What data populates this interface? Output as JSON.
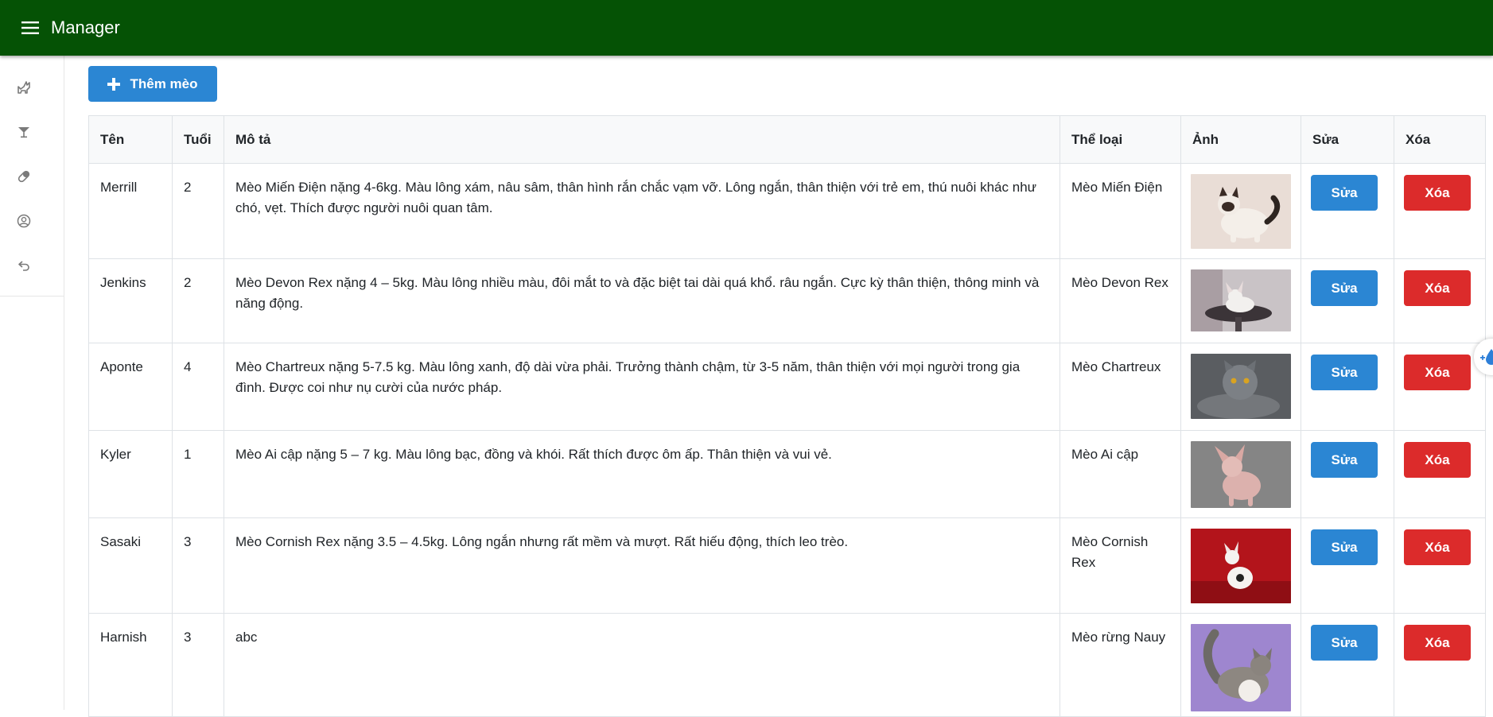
{
  "app": {
    "title": "Manager"
  },
  "sidebar": {
    "items": [
      {
        "icon": "cat-icon"
      },
      {
        "icon": "cocktail-icon"
      },
      {
        "icon": "pill-icon"
      },
      {
        "icon": "account-circle-icon"
      },
      {
        "icon": "undo-icon"
      }
    ]
  },
  "toolbar": {
    "add_label": "Thêm mèo"
  },
  "table": {
    "headers": [
      "Tên",
      "Tuổi",
      "Mô tả",
      "Thể loại",
      "Ảnh",
      "Sửa",
      "Xóa"
    ],
    "rows": [
      {
        "name": "Merrill",
        "age": "2",
        "desc": "Mèo Miến Điện nặng 4-6kg. Màu lông xám, nâu sâm, thân hình rắn chắc vạm vỡ. Lông ngắn, thân thiện với trẻ em, thú nuôi khác như chó, vẹt. Thích được người nuôi quan tâm.",
        "category": "Mèo Miến Điện",
        "edit_label": "Sửa",
        "delete_label": "Xóa"
      },
      {
        "name": "Jenkins",
        "age": "2",
        "desc": "Mèo Devon Rex nặng 4 – 5kg. Màu lông nhiều màu, đôi mắt to và đặc biệt tai dài quá khổ. râu ngắn. Cực kỳ thân thiện, thông minh và năng động.",
        "category": "Mèo Devon Rex",
        "edit_label": "Sửa",
        "delete_label": "Xóa"
      },
      {
        "name": "Aponte",
        "age": "4",
        "desc": "Mèo Chartreux nặng 5-7.5 kg. Màu lông xanh, độ dài vừa phải. Trưởng thành chậm, từ 3-5 năm, thân thiện với mọi người trong gia đình. Được coi như nụ cười của nước pháp.",
        "category": "Mèo Chartreux",
        "edit_label": "Sửa",
        "delete_label": "Xóa"
      },
      {
        "name": "Kyler",
        "age": "1",
        "desc": "Mèo Ai cập nặng 5 – 7 kg. Màu lông bạc, đồng và khói. Rất thích được ôm ấp. Thân thiện và vui vẻ.",
        "category": "Mèo Ai cập",
        "edit_label": "Sửa",
        "delete_label": "Xóa"
      },
      {
        "name": "Sasaki",
        "age": "3",
        "desc": "Mèo Cornish Rex nặng 3.5 – 4.5kg. Lông ngắn nhưng rất mềm và mượt. Rất hiếu động, thích leo trèo.",
        "category": "Mèo Cornish Rex",
        "edit_label": "Sửa",
        "delete_label": "Xóa"
      },
      {
        "name": "Harnish",
        "age": "3",
        "desc": "abc",
        "category": "Mèo rừng Nauy",
        "edit_label": "Sửa",
        "delete_label": "Xóa"
      }
    ]
  },
  "colors": {
    "appbar": "#055205",
    "primary": "#2b86d3",
    "danger": "#dc2b2b"
  }
}
